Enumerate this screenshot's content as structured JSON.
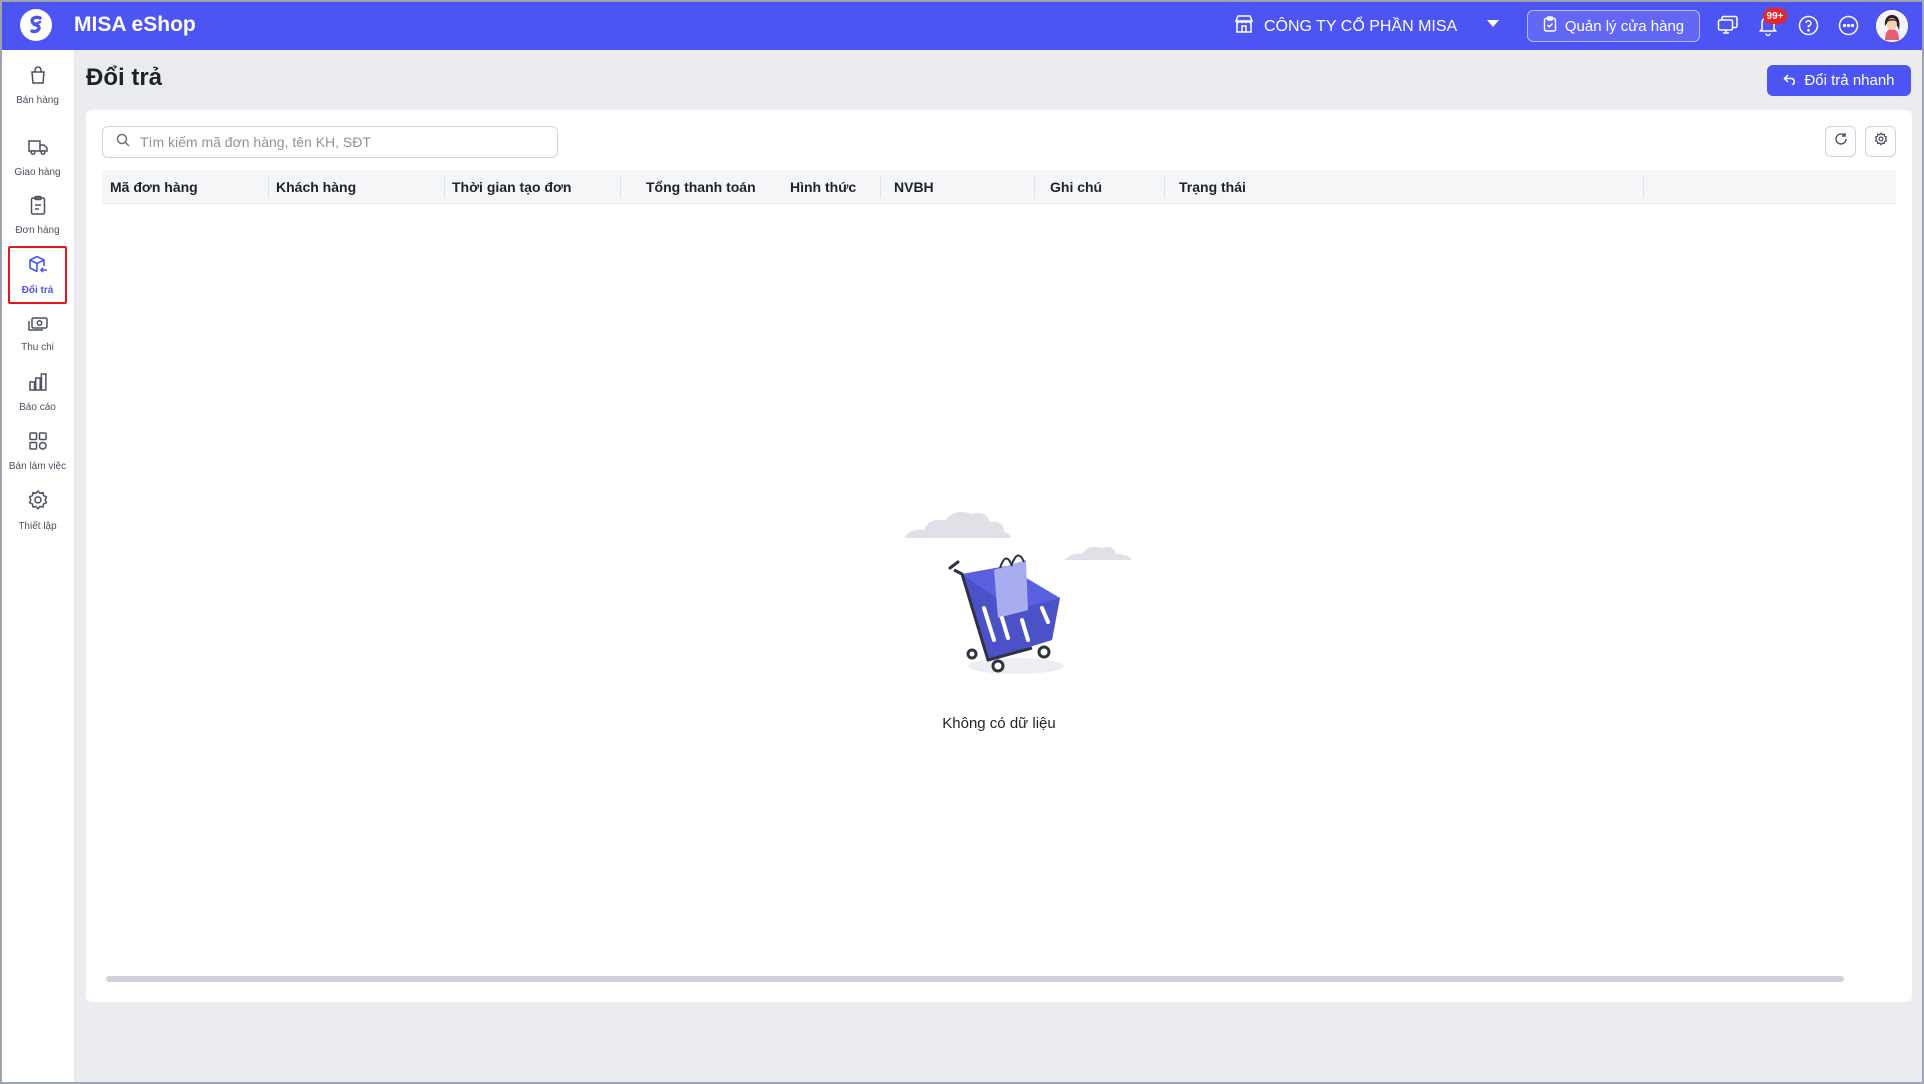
{
  "app": {
    "name": "MISA eShop"
  },
  "header": {
    "company": "CÔNG TY CỔ PHẦN MISA",
    "store_manage_label": "Quản lý cửa hàng",
    "notification_badge": "99+"
  },
  "sidebar": {
    "items": [
      {
        "label": "Bán hàng",
        "icon": "shopping-bag-icon"
      },
      {
        "label": "Giao hàng",
        "icon": "delivery-truck-icon"
      },
      {
        "label": "Đơn hàng",
        "icon": "clipboard-icon"
      },
      {
        "label": "Đổi trả",
        "icon": "return-box-icon",
        "active": true
      },
      {
        "label": "Thu chi",
        "icon": "cash-icon"
      },
      {
        "label": "Báo cáo",
        "icon": "bar-chart-icon"
      },
      {
        "label": "Bàn làm việc",
        "icon": "grid-icon"
      },
      {
        "label": "Thiết lập",
        "icon": "gear-icon"
      }
    ]
  },
  "page": {
    "title": "Đổi trả",
    "quick_return_label": "Đổi trả nhanh",
    "search_placeholder": "Tìm kiếm mã đơn hàng, tên KH, SĐT",
    "columns": [
      "Mã đơn hàng",
      "Khách hàng",
      "Thời gian tạo đơn",
      "Tổng thanh toán",
      "Hình thức",
      "NVBH",
      "Ghi chú",
      "Trạng thái"
    ],
    "empty_text": "Không có dữ liệu"
  },
  "colors": {
    "brand": "#4d54f4",
    "active_outline": "#e4151b",
    "badge": "#e8242f"
  }
}
